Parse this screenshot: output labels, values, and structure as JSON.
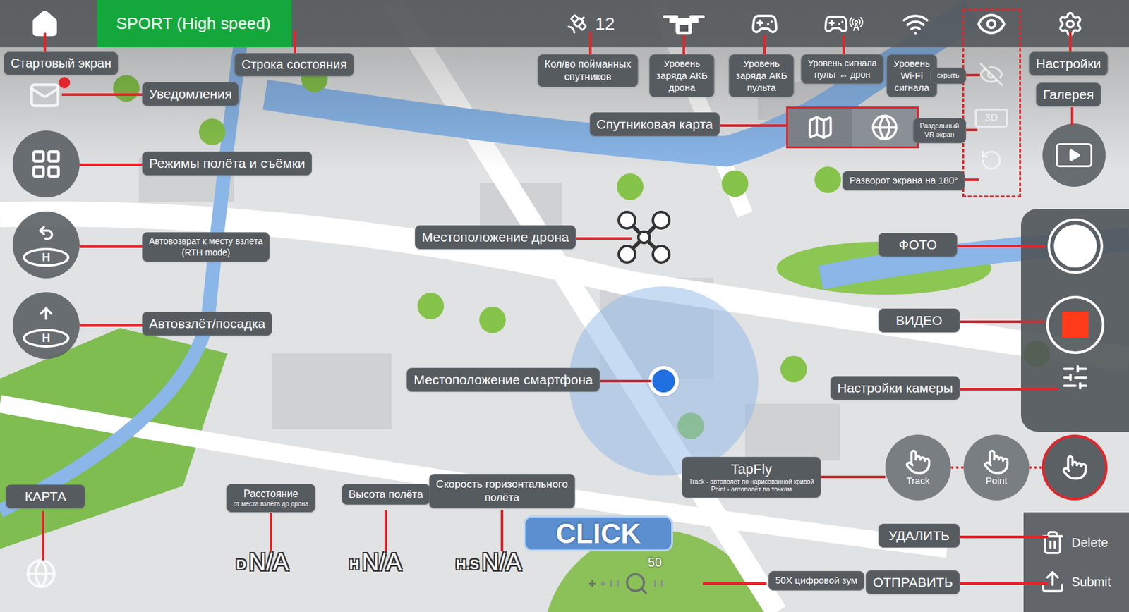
{
  "top_bar": {
    "mode": "SPORT (High speed)",
    "satellites": "12",
    "vr_badge": "3D",
    "pad_letter": "H"
  },
  "annotations": {
    "home": [
      "Стартовый экран"
    ],
    "status": [
      "Строка состояния"
    ],
    "satellites": [
      "Кол/во пойманных",
      "спутников"
    ],
    "drone_battery": [
      "Уровень",
      "заряда АКБ",
      "дрона"
    ],
    "remote_battery": [
      "Уровень",
      "заряда АКБ",
      "пульта"
    ],
    "link_signal": [
      "Уровень сигнала",
      "пульт ↔ дрон"
    ],
    "wifi": [
      "Уровень",
      "Wi-Fi",
      "сигнала"
    ],
    "settings": [
      "Настройки"
    ],
    "gallery": [
      "Галерея"
    ],
    "hide": [
      "скрыть"
    ],
    "vr": [
      "Раздельный",
      "VR экран"
    ],
    "rotate": [
      "Разворот экрана на 180°"
    ],
    "notifications": [
      "Уведомления"
    ],
    "modes": [
      "Режимы полёта и съёмки"
    ],
    "rth": [
      "Автовозврат к месту взлёта",
      "(RTH mode)"
    ],
    "takeoff": [
      "Автовзлёт/посадка"
    ],
    "satellite_map": [
      "Спутниковая карта"
    ],
    "drone_location": [
      "Местоположение дрона"
    ],
    "phone_location": [
      "Местоположение смартфона"
    ],
    "photo": [
      "ФОТО"
    ],
    "video": [
      "ВИДЕО"
    ],
    "camera_settings": [
      "Настройки камеры"
    ],
    "delete": [
      "УДАЛИТЬ"
    ],
    "submit": [
      "ОТПРАВИТЬ"
    ],
    "map": [
      "КАРТА"
    ],
    "distance": [
      "Расстояние",
      "от места взлёта до дрона"
    ],
    "height": [
      "Высота полёта"
    ],
    "hspeed": [
      "Скорость горизонтального",
      "полёта"
    ],
    "zoom": [
      "50X цифровой зум"
    ],
    "tapfly": [
      "TapFly",
      "Track - автополёт по нарисованной кривой",
      "Point - автополёт по точкам"
    ]
  },
  "telemetry": [
    {
      "prefix": "D",
      "value": "N/A"
    },
    {
      "prefix": "H",
      "value": "N/A"
    },
    {
      "prefix": "H.S",
      "value": "N/A"
    }
  ],
  "tapfly_modes": [
    {
      "label": "Track",
      "selected": false
    },
    {
      "label": "Point",
      "selected": false
    },
    {
      "label": "",
      "selected": true
    }
  ],
  "click_button": "CLICK",
  "zoom": {
    "value": "50",
    "min_mark": "+"
  },
  "actions": [
    {
      "label": "Delete",
      "kind": "delete"
    },
    {
      "label": "Submit",
      "kind": "submit"
    }
  ]
}
